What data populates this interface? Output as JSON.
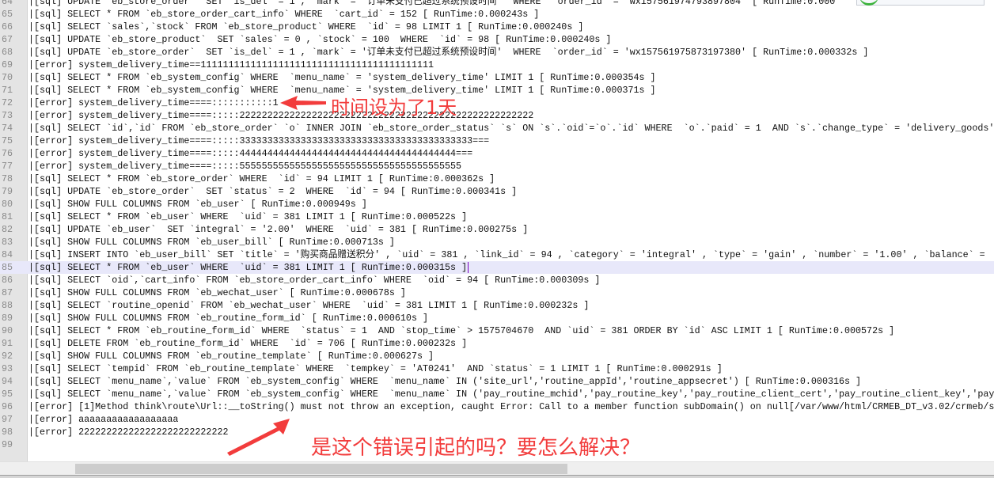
{
  "editor": {
    "current_line": 85,
    "lines": [
      {
        "num": "64",
        "text": "|[sql] UPDATE `eb_store_order`  SET `is_del` = 1 , `mark` = '订单未支付已超过系统预设时间'  WHERE  `order_id` = 'wx157561974793897804' [ RunTime:0.000"
      },
      {
        "num": "65",
        "text": "|[sql] SELECT * FROM `eb_store_order_cart_info` WHERE  `cart_id` = 152 [ RunTime:0.000243s ]"
      },
      {
        "num": "66",
        "text": "|[sql] SELECT `sales`,`stock` FROM `eb_store_product` WHERE  `id` = 98 LIMIT 1 [ RunTime:0.000240s ]"
      },
      {
        "num": "67",
        "text": "|[sql] UPDATE `eb_store_product`  SET `sales` = 0 , `stock` = 100  WHERE  `id` = 98 [ RunTime:0.000240s ]"
      },
      {
        "num": "68",
        "text": "|[sql] UPDATE `eb_store_order`  SET `is_del` = 1 , `mark` = '订单未支付已超过系统预设时间'  WHERE  `order_id` = 'wx157561975873197380' [ RunTime:0.000332s ]"
      },
      {
        "num": "69",
        "text": "|[error] system_delivery_time==111111111111111111111111111111111111111111"
      },
      {
        "num": "70",
        "text": "|[sql] SELECT * FROM `eb_system_config` WHERE  `menu_name` = 'system_delivery_time' LIMIT 1 [ RunTime:0.000354s ]"
      },
      {
        "num": "71",
        "text": "|[sql] SELECT * FROM `eb_system_config` WHERE  `menu_name` = 'system_delivery_time' LIMIT 1 [ RunTime:0.000371s ]"
      },
      {
        "num": "72",
        "text": "|[error] system_delivery_time====:::::::::::1"
      },
      {
        "num": "73",
        "text": "|[error] system_delivery_time====:::::22222222222222222222222222222222222222222222222222222"
      },
      {
        "num": "74",
        "text": "|[sql] SELECT `id`,`id` FROM `eb_store_order` `o` INNER JOIN `eb_store_order_status` `s` ON `s`.`oid`=`o`.`id` WHERE  `o`.`paid` = 1  AND `s`.`change_type` = 'delivery_goods'"
      },
      {
        "num": "75",
        "text": "|[error] system_delivery_time====:::::333333333333333333333333333333333333333333==="
      },
      {
        "num": "76",
        "text": "|[error] system_delivery_time====:::::444444444444444444444444444444444444444==="
      },
      {
        "num": "77",
        "text": "|[error] system_delivery_time====:::::5555555555555555555555555555555555555555"
      },
      {
        "num": "78",
        "text": "|[sql] SELECT * FROM `eb_store_order` WHERE  `id` = 94 LIMIT 1 [ RunTime:0.000362s ]"
      },
      {
        "num": "79",
        "text": "|[sql] UPDATE `eb_store_order`  SET `status` = 2  WHERE  `id` = 94 [ RunTime:0.000341s ]"
      },
      {
        "num": "80",
        "text": "|[sql] SHOW FULL COLUMNS FROM `eb_user` [ RunTime:0.000949s ]"
      },
      {
        "num": "81",
        "text": "|[sql] SELECT * FROM `eb_user` WHERE  `uid` = 381 LIMIT 1 [ RunTime:0.000522s ]"
      },
      {
        "num": "82",
        "text": "|[sql] UPDATE `eb_user`  SET `integral` = '2.00'  WHERE  `uid` = 381 [ RunTime:0.000275s ]"
      },
      {
        "num": "83",
        "text": "|[sql] SHOW FULL COLUMNS FROM `eb_user_bill` [ RunTime:0.000713s ]"
      },
      {
        "num": "84",
        "text": "|[sql] INSERT INTO `eb_user_bill` SET `title` = '购买商品赠送积分' , `uid` = 381 , `link_id` = 94 , `category` = 'integral' , `type` = 'gain' , `number` = '1.00' , `balance` ="
      },
      {
        "num": "85",
        "text": "|[sql] SELECT * FROM `eb_user` WHERE  `uid` = 381 LIMIT 1 [ RunTime:0.000315s ]"
      },
      {
        "num": "86",
        "text": "|[sql] SELECT `oid`,`cart_info` FROM `eb_store_order_cart_info` WHERE  `oid` = 94 [ RunTime:0.000309s ]"
      },
      {
        "num": "87",
        "text": "|[sql] SHOW FULL COLUMNS FROM `eb_wechat_user` [ RunTime:0.000678s ]"
      },
      {
        "num": "88",
        "text": "|[sql] SELECT `routine_openid` FROM `eb_wechat_user` WHERE  `uid` = 381 LIMIT 1 [ RunTime:0.000232s ]"
      },
      {
        "num": "89",
        "text": "|[sql] SHOW FULL COLUMNS FROM `eb_routine_form_id` [ RunTime:0.000610s ]"
      },
      {
        "num": "90",
        "text": "|[sql] SELECT * FROM `eb_routine_form_id` WHERE  `status` = 1  AND `stop_time` > 1575704670  AND `uid` = 381 ORDER BY `id` ASC LIMIT 1 [ RunTime:0.000572s ]"
      },
      {
        "num": "91",
        "text": "|[sql] DELETE FROM `eb_routine_form_id` WHERE  `id` = 706 [ RunTime:0.000232s ]"
      },
      {
        "num": "92",
        "text": "|[sql] SHOW FULL COLUMNS FROM `eb_routine_template` [ RunTime:0.000627s ]"
      },
      {
        "num": "93",
        "text": "|[sql] SELECT `tempid` FROM `eb_routine_template` WHERE  `tempkey` = 'AT0241'  AND `status` = 1 LIMIT 1 [ RunTime:0.000291s ]"
      },
      {
        "num": "94",
        "text": "|[sql] SELECT `menu_name`,`value` FROM `eb_system_config` WHERE  `menu_name` IN ('site_url','routine_appId','routine_appsecret') [ RunTime:0.000316s ]"
      },
      {
        "num": "95",
        "text": "|[sql] SELECT `menu_name`,`value` FROM `eb_system_config` WHERE  `menu_name` IN ('pay_routine_mchid','pay_routine_key','pay_routine_client_cert','pay_routine_client_key','pay_"
      },
      {
        "num": "96",
        "text": "|[error] [1]Method think\\route\\Url::__toString() must not throw an exception, caught Error: Call to a member function subDomain() on null[/var/www/html/CRMEB_DT_v3.02/crmeb/se"
      },
      {
        "num": "97",
        "text": "|[error] aaaaaaaaaaaaaaaaaa"
      },
      {
        "num": "98",
        "text": "|[error] 222222222222222222222222222"
      },
      {
        "num": "99",
        "text": ""
      }
    ]
  },
  "annotations": {
    "note1": "时间设为了1天",
    "note2": "是这个错误引起的吗？要怎么解决？",
    "color": "#f23c3c"
  },
  "scrollbar": {
    "horizontal_position": 0.06
  }
}
